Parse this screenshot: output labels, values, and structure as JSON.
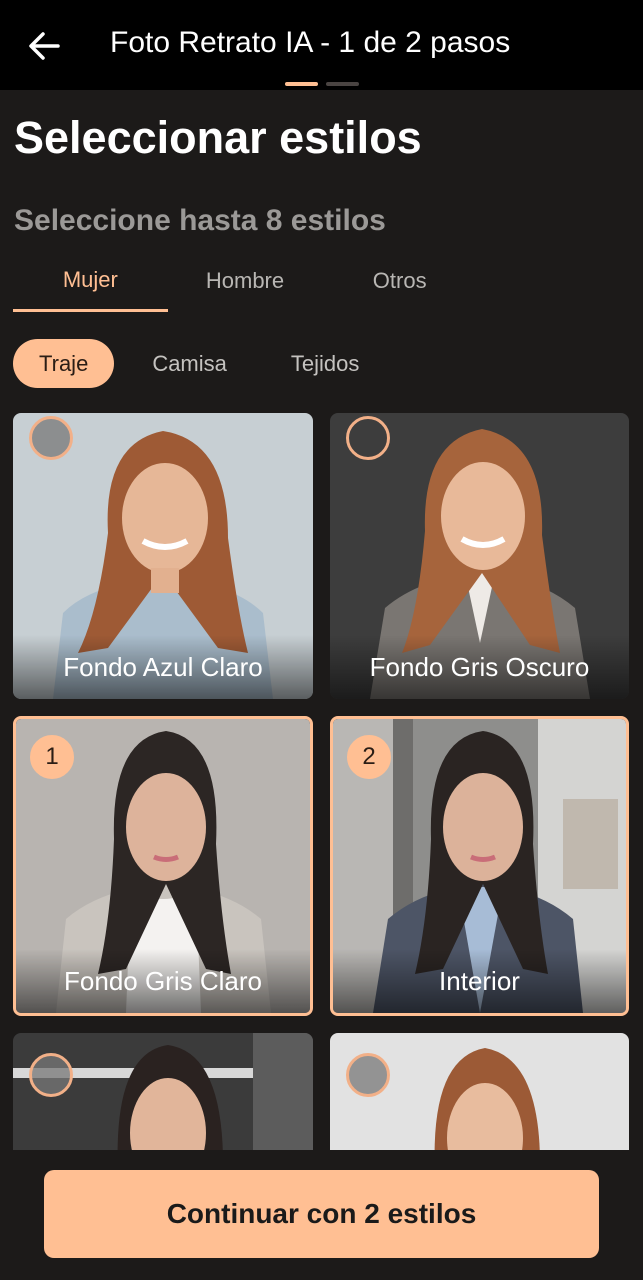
{
  "header": {
    "title": "Foto Retrato IA - 1 de 2 pasos",
    "back_icon": "arrow-left-icon",
    "steps": [
      {
        "active": true,
        "color": "#ffbf93"
      },
      {
        "active": false,
        "color": "#4a4442"
      }
    ]
  },
  "page": {
    "title": "Seleccionar estilos",
    "subtitle": "Seleccione hasta 8 estilos"
  },
  "gender_tabs": [
    {
      "label": "Mujer",
      "active": true
    },
    {
      "label": "Hombre",
      "active": false
    },
    {
      "label": "Otros",
      "active": false
    }
  ],
  "style_chips": [
    {
      "label": "Traje",
      "active": true
    },
    {
      "label": "Camisa",
      "active": false
    },
    {
      "label": "Tejidos",
      "active": false
    }
  ],
  "styles": [
    {
      "label": "Fondo Azul Claro",
      "selected": false,
      "order": ""
    },
    {
      "label": "Fondo Gris Oscuro",
      "selected": false,
      "order": ""
    },
    {
      "label": "Fondo Gris Claro",
      "selected": true,
      "order": "1"
    },
    {
      "label": "Interior",
      "selected": true,
      "order": "2"
    },
    {
      "label": "",
      "selected": false,
      "order": ""
    },
    {
      "label": "",
      "selected": false,
      "order": ""
    }
  ],
  "footer": {
    "continue_label": "Continuar con 2 estilos"
  },
  "colors": {
    "accent": "#ffbf93",
    "background": "#1c1a19",
    "header_background": "#000000"
  }
}
